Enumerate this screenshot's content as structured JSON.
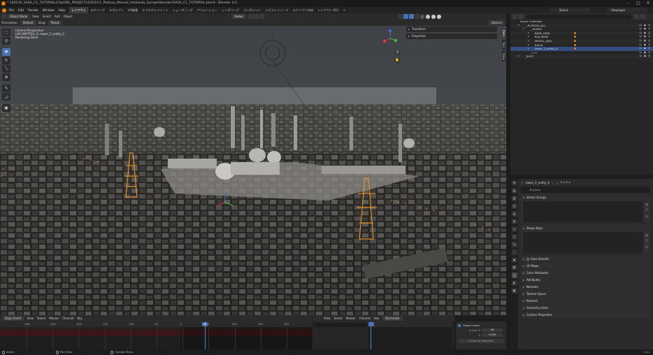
{
  "window": {
    "title": "* 240116_SASA_C1_TUTORIAL(CityGML_PROJECT)\\2023\\C1_Plateau_Manual_Hokkaido_Sample\\blender\\SASA_C1_TUTORIAL.blend - Blender 4.0",
    "controls": [
      "–",
      "□",
      "✕"
    ]
  },
  "menubar": {
    "menus": [
      "File",
      "Edit",
      "Render",
      "Window",
      "Help"
    ],
    "workspaces": [
      "レイアウト",
      "モデリング",
      "スカルプト",
      "UV編集",
      "テクスチャペイント",
      "シェーディング",
      "アニメーション",
      "レンダリング",
      "コンポジット",
      "ジオメトリノード",
      "スクリプト作成",
      "レイアウト.001",
      "+"
    ],
    "active_workspace": 0,
    "scene": "Scene",
    "view_layer": "ViewLayer"
  },
  "viewport_header": {
    "mode": "Object Mode",
    "menus": [
      "View",
      "Select",
      "Add",
      "Object"
    ],
    "orientation": "Global"
  },
  "tool_settings": {
    "orientation_label": "Orientation:",
    "orientation_value": "Default",
    "drag_label": "Drag:",
    "drag_value": "Tweak",
    "options": "Options"
  },
  "viewport": {
    "info_lines": [
      "Camera Perspective",
      "(46) ENTITIES_0 | tower_2_entity_0",
      "Rendering Done"
    ],
    "npanel": [
      "Transform",
      "Properties"
    ],
    "side_tabs": [
      "Item",
      "Tool",
      "View"
    ]
  },
  "outliner": {
    "rows": [
      {
        "label": "Scene Collection",
        "depth": 0,
        "expand": ""
      },
      {
        "label": "__PLATEAU_ALL",
        "depth": 1,
        "expand": "▾"
      },
      {
        "label": "__MODEL",
        "depth": 2,
        "expand": "▾"
      },
      {
        "label": "BASE_GRID",
        "depth": 3,
        "expand": "▸"
      },
      {
        "label": "BLD_BASE",
        "depth": 3,
        "expand": "▸"
      },
      {
        "label": "MODEL_ADD",
        "depth": 3,
        "expand": "▸"
      },
      {
        "label": "BUILD",
        "depth": 3,
        "expand": "▸"
      },
      {
        "label": "tower_2_entity_0",
        "depth": 3,
        "expand": "▸",
        "selected": true
      },
      {
        "label": "_CAM",
        "depth": 2,
        "expand": "",
        "dim": true
      },
      {
        "label": "_SHOT",
        "depth": 1,
        "expand": "▸"
      }
    ]
  },
  "properties": {
    "breadcrumb": "tower_2_entity_0",
    "breadcrumb_sub": "メッシュ",
    "mesh_name": "メッシュ",
    "panels": [
      {
        "label": "Vertex Groups",
        "open": true
      },
      {
        "label": "Shape Keys",
        "open": true
      },
      {
        "label": "Auto Smooth",
        "open": false,
        "checkbox": true
      },
      {
        "label": "UV Maps",
        "open": false
      },
      {
        "label": "Color Attributes",
        "open": false
      },
      {
        "label": "Attributes",
        "open": false
      },
      {
        "label": "Normals",
        "open": false
      },
      {
        "label": "Texture Space",
        "open": false
      },
      {
        "label": "Remesh",
        "open": false
      },
      {
        "label": "Geometry Data",
        "open": false
      },
      {
        "label": "Custom Properties",
        "open": false
      }
    ]
  },
  "timeline": {
    "editor": "Dope Sheet",
    "menus": [
      "View",
      "Select",
      "Marker",
      "Channel",
      "Key"
    ],
    "ruler": [
      "-300",
      "-250",
      "-200",
      "-150",
      "-100",
      "-50",
      "0",
      "50",
      "100",
      "150",
      "200"
    ],
    "current_frame": "46"
  },
  "dopesheet": {
    "menus": [
      "View",
      "Select",
      "Marker",
      "Channel",
      "Key"
    ],
    "normalize": "Normalize",
    "current_frame": "46"
  },
  "cursor_panel": {
    "show_cursor": "Show Cursor",
    "cursor_x_label": "Cursor X",
    "cursor_x": "46",
    "y_label": "Y",
    "y": "0.000",
    "button": "Cursor to Selection"
  },
  "statusbar": {
    "select": "Select",
    "pan": "Pan View",
    "context": "Context Menu",
    "version": "4.0.1"
  },
  "colors": {
    "accent": "#4772b3",
    "blender_orange": "#e87d0d",
    "selected_row": "#334d80"
  }
}
